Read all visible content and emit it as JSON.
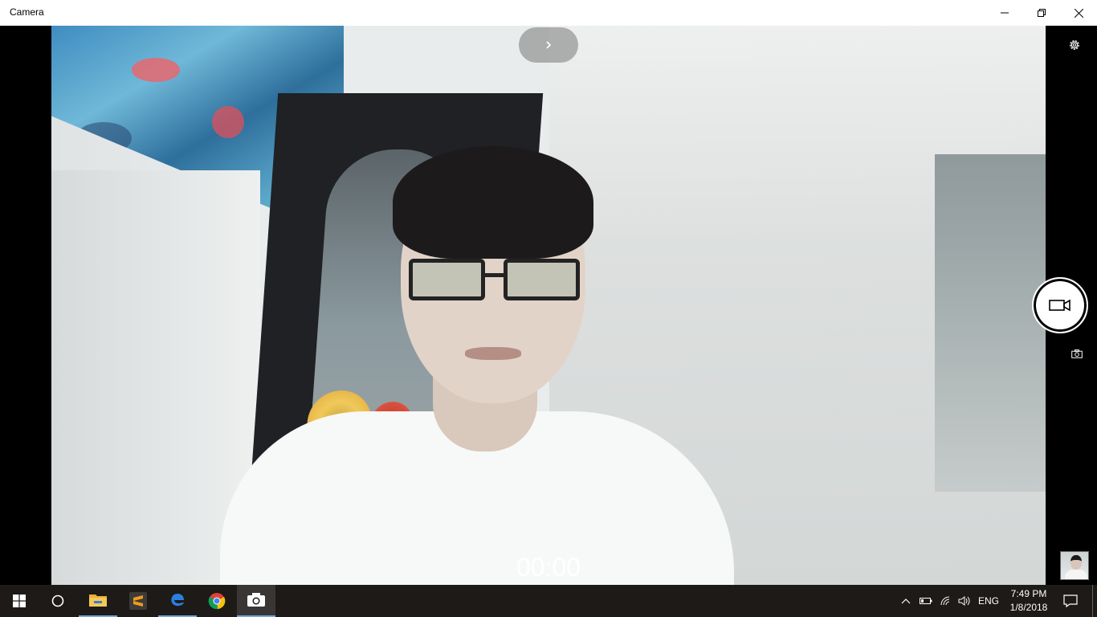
{
  "window": {
    "title": "Camera"
  },
  "title_controls": [
    "minimize-icon",
    "maximize-icon",
    "close-icon"
  ],
  "camera": {
    "timer": "00:00",
    "controls": {
      "expand_icon": "chevron-right-icon",
      "settings_icon": "gear-icon",
      "video_mode_icon": "video-camera-icon",
      "photo_mode_icon": "camera-icon"
    }
  },
  "taskbar": {
    "apps": [
      "start-icon",
      "search-icon",
      "file-explorer-icon",
      "sublime-text-icon",
      "edge-icon",
      "chrome-icon",
      "camera-app-icon"
    ],
    "tray": {
      "language": "ENG",
      "time": "7:49 PM",
      "date": "1/8/2018",
      "icons": [
        "chevron-up-icon",
        "battery-icon",
        "wifi-icon",
        "volume-icon",
        "action-center-icon"
      ]
    }
  },
  "colors": {
    "taskbar": "#1d1a18",
    "accent": "#7aa6d6",
    "titlebar": "#ffffff"
  }
}
